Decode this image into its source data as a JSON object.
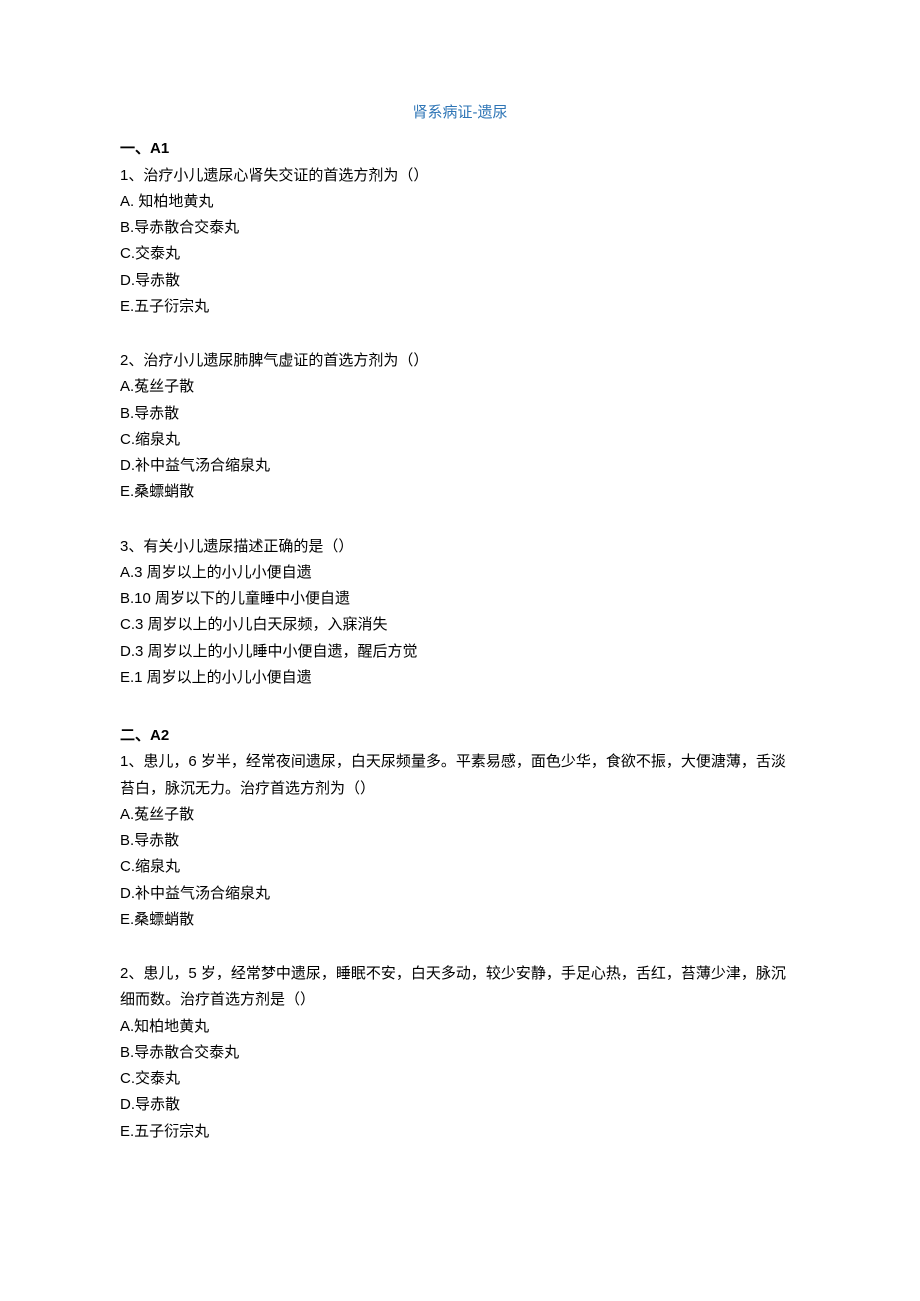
{
  "title": "肾系病证-遗尿",
  "sections": [
    {
      "header": "一、A1",
      "questions": [
        {
          "num": "1、",
          "text": "治疗小儿遗尿心肾失交证的首选方剂为（）",
          "options": [
            "A. 知柏地黄丸",
            "B.导赤散合交泰丸",
            "C.交泰丸",
            "D.导赤散",
            "E.五子衍宗丸"
          ]
        },
        {
          "num": "2、",
          "text": "治疗小儿遗尿肺脾气虚证的首选方剂为（）",
          "options": [
            "A.菟丝子散",
            "B.导赤散",
            "C.缩泉丸",
            "D.补中益气汤合缩泉丸",
            "E.桑螵蛸散"
          ]
        },
        {
          "num": "3、",
          "text": "有关小儿遗尿描述正确的是（）",
          "options": [
            "A.3 周岁以上的小儿小便自遗",
            "B.10 周岁以下的儿童睡中小便自遗",
            "C.3 周岁以上的小儿白天尿频，入寐消失",
            "D.3 周岁以上的小儿睡中小便自遗，醒后方觉",
            "E.1 周岁以上的小儿小便自遗"
          ]
        }
      ]
    },
    {
      "header": "二、A2",
      "questions": [
        {
          "num": "1、",
          "text": "患儿，6 岁半，经常夜间遗尿，白天尿频量多。平素易感，面色少华，食欲不振，大便溏薄，舌淡苔白，脉沉无力。治疗首选方剂为（）",
          "options": [
            "A.菟丝子散",
            "B.导赤散",
            "C.缩泉丸",
            "D.补中益气汤合缩泉丸",
            "E.桑螵蛸散"
          ]
        },
        {
          "num": "2、",
          "text": "患儿，5 岁，经常梦中遗尿，睡眠不安，白天多动，较少安静，手足心热，舌红，苔薄少津，脉沉细而数。治疗首选方剂是（）",
          "options": [
            "A.知柏地黄丸",
            "B.导赤散合交泰丸",
            "C.交泰丸",
            "D.导赤散",
            "E.五子衍宗丸"
          ]
        }
      ]
    }
  ]
}
